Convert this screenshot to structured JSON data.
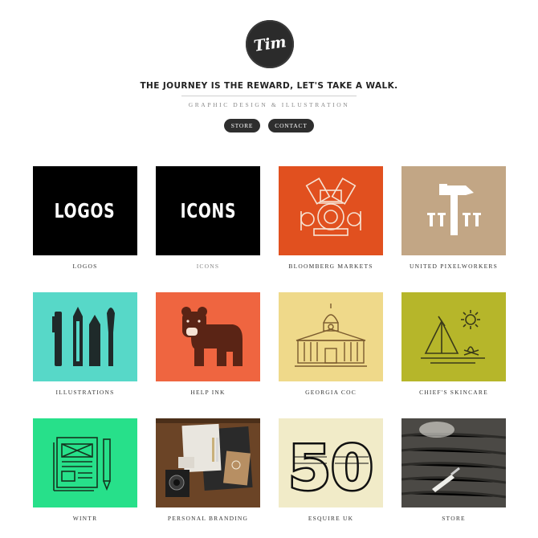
{
  "header": {
    "logo_text": "Tim",
    "tagline": "THE JOURNEY IS THE REWARD, LET'S TAKE A WALK.",
    "subtitle": "GRAPHIC DESIGN & ILLUSTRATION",
    "nav": [
      {
        "label": "STORE"
      },
      {
        "label": "CONTACT"
      }
    ]
  },
  "portfolio": [
    {
      "caption": "LOGOS",
      "thumb_text": "LOGOS",
      "bg": "#000000"
    },
    {
      "caption": "ICONS",
      "thumb_text": "ICONS",
      "bg": "#000000"
    },
    {
      "caption": "BLOOMBERG MARKETS",
      "bg": "#e1501f"
    },
    {
      "caption": "UNITED PIXELWORKERS",
      "bg": "#c2a685"
    },
    {
      "caption": "ILLUSTRATIONS",
      "bg": "#57d8c8"
    },
    {
      "caption": "HELP INK",
      "bg": "#ef6540"
    },
    {
      "caption": "GEORGIA COC",
      "bg": "#efd98a"
    },
    {
      "caption": "CHIEF'S SKINCARE",
      "bg": "#b6b62a"
    },
    {
      "caption": "WINTR",
      "bg": "#27e08a"
    },
    {
      "caption": "PERSONAL BRANDING",
      "bg": "#6b4426"
    },
    {
      "caption": "ESQUIRE UK",
      "thumb_text": "50",
      "bg": "#f1ebc8"
    },
    {
      "caption": "STORE",
      "bg": "#4b4945"
    }
  ]
}
